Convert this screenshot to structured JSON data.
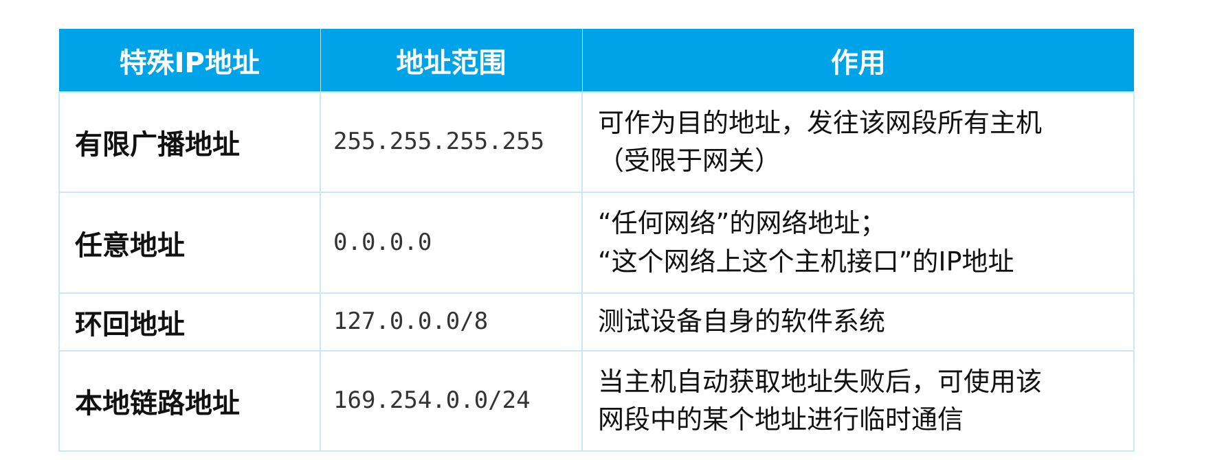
{
  "table": {
    "headers": [
      "特殊IP地址",
      "地址范围",
      "作用"
    ],
    "rows": [
      {
        "name": "有限广播地址",
        "range": "255.255.255.255",
        "usage_lines": [
          "可作为目的地址，发往该网段所有主机",
          "（受限于网关）"
        ]
      },
      {
        "name": "任意地址",
        "range": "0.0.0.0",
        "usage_lines": [
          "“任何网络”的网络地址；",
          "“这个网络上这个主机接口”的IP地址"
        ]
      },
      {
        "name": "环回地址",
        "range": "127.0.0.0/8",
        "usage_lines": [
          "测试设备自身的软件系统"
        ]
      },
      {
        "name": "本地链路地址",
        "range": "169.254.0.0/24",
        "usage_lines": [
          "当主机自动获取地址失败后，可使用该",
          "网段中的某个地址进行临时通信"
        ]
      }
    ]
  },
  "colors": {
    "header_bg": "#00a2e8",
    "header_text": "#ffffff",
    "grid_line": "#c9e8f5"
  }
}
